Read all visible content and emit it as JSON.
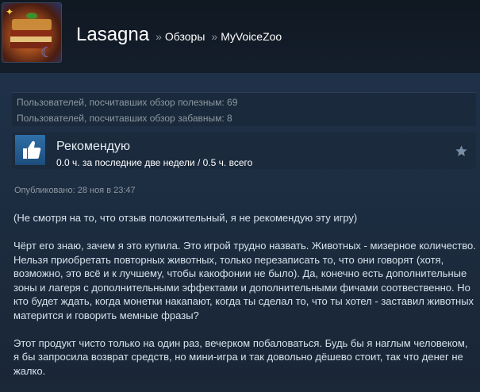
{
  "header": {
    "user_name": "Lasagna",
    "separator_1": "»",
    "reviews_link": "Обзоры",
    "separator_2": "»",
    "game_name": "MyVoiceZoo"
  },
  "stats": {
    "helpful": "Пользователей, посчитавших обзор полезным: 69",
    "funny": "Пользователей, посчитавших обзор забавным: 8"
  },
  "verdict": {
    "title": "Рекомендую",
    "hours": "0.0 ч. за последние две недели / 0.5 ч. всего",
    "thumb_icon": "thumbs-up-icon",
    "star_icon": "star-icon"
  },
  "posted": "Опубликовано: 28 ноя в 23:47",
  "review": {
    "paragraphs": [
      "(Не смотря на то, что отзыв положительный, я не рекомендую эту игру)",
      "Чёрт его знаю, зачем я это купила. Это игрой трудно назвать. Животных - мизерное количество. Нельзя приобретать повторных животных, только перезаписать то, что они говорят (хотя, возможно, это всё и к лучшему, чтобы какофонии не было). Да, конечно есть дополнительные зоны и лагеря с дополнительными эффектами и дополнительными фичами соотвественно. Но кто будет ждать, когда монетки накапают, когда ты сделал то, что ты хотел - заставил животных матерится и говорить мемные фразы?",
      "Этот продукт чисто только на один раз, вечерком побаловаться. Будь бы я наглым человеком, я бы запросила возврат средств, но мини-игра и так довольно дёшево стоит, так что денег не жалко."
    ]
  },
  "colors": {
    "background": "#1b2838",
    "thumb": "#2f6fa8",
    "muted_text": "#8f98a0"
  }
}
